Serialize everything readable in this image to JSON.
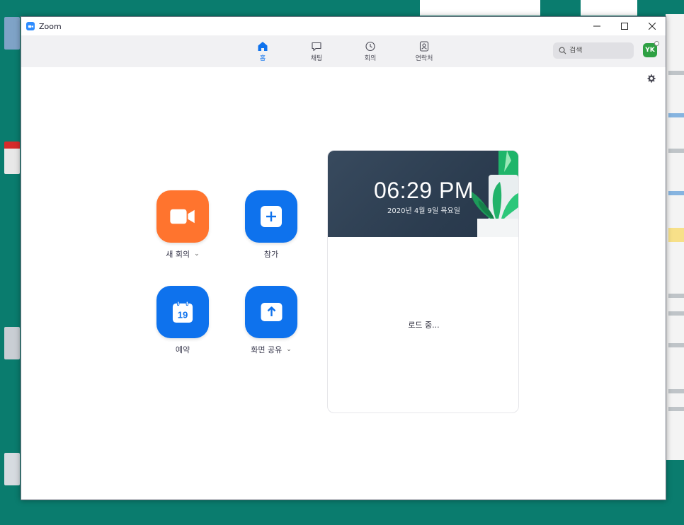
{
  "window": {
    "title": "Zoom"
  },
  "nav": {
    "tabs": [
      {
        "label": "홈",
        "icon": "home-icon",
        "active": true
      },
      {
        "label": "채팅",
        "icon": "chat-icon",
        "active": false
      },
      {
        "label": "회의",
        "icon": "clock-icon",
        "active": false
      },
      {
        "label": "연락처",
        "icon": "contacts-icon",
        "active": false
      }
    ],
    "search_placeholder": "검색",
    "avatar_initials": "YK"
  },
  "actions": {
    "new_meeting": "새 회의",
    "join": "참가",
    "schedule": "예약",
    "schedule_day": "19",
    "share_screen": "화면 공유"
  },
  "clock": {
    "time": "06:29 PM",
    "date": "2020년 4월 9일 목요일"
  },
  "status": {
    "loading": "로드 중..."
  },
  "colors": {
    "accent": "#0e72ed",
    "new_meeting": "#ff742e",
    "avatar": "#2ea043",
    "banner": "#2c3d50"
  }
}
